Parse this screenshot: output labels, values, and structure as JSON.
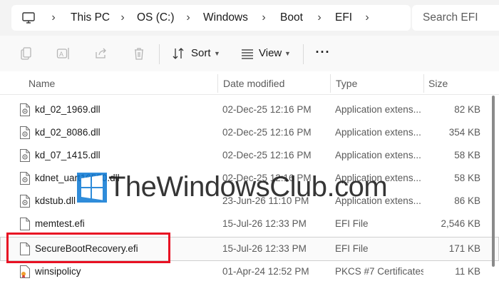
{
  "address": {
    "crumbs": [
      "This PC",
      "OS (C:)",
      "Windows",
      "Boot",
      "EFI"
    ],
    "root_icon": "monitor-icon",
    "separator_icon": "chevron-right-icon"
  },
  "search": {
    "placeholder": "Search EFI"
  },
  "toolbar": {
    "icons": [
      "copy-icon",
      "rename-icon",
      "share-icon",
      "delete-icon"
    ],
    "sort_label": "Sort",
    "view_label": "View",
    "more_label": "···"
  },
  "columns": {
    "name": "Name",
    "date": "Date modified",
    "type": "Type",
    "size": "Size"
  },
  "files": [
    {
      "name": "kd_02_1969.dll",
      "date": "02-Dec-25 12:16 PM",
      "type": "Application extens...",
      "size": "82 KB",
      "icon": "dll-file-icon"
    },
    {
      "name": "kd_02_8086.dll",
      "date": "02-Dec-25 12:16 PM",
      "type": "Application extens...",
      "size": "354 KB",
      "icon": "dll-file-icon"
    },
    {
      "name": "kd_07_1415.dll",
      "date": "02-Dec-25 12:16 PM",
      "type": "Application extens...",
      "size": "58 KB",
      "icon": "dll-file-icon"
    },
    {
      "name": "kdnet_uart16550.dll",
      "date": "02-Dec-25 12:16 PM",
      "type": "Application extens...",
      "size": "58 KB",
      "icon": "dll-file-icon"
    },
    {
      "name": "kdstub.dll",
      "date": "23-Jun-26 11:10 PM",
      "type": "Application extens...",
      "size": "86 KB",
      "icon": "dll-file-icon"
    },
    {
      "name": "memtest.efi",
      "date": "15-Jul-26 12:33 PM",
      "type": "EFI File",
      "size": "2,546 KB",
      "icon": "file-icon"
    },
    {
      "name": "SecureBootRecovery.efi",
      "date": "15-Jul-26 12:33 PM",
      "type": "EFI File",
      "size": "171 KB",
      "icon": "file-icon"
    },
    {
      "name": "winsipolicy",
      "date": "01-Apr-24 12:52 PM",
      "type": "PKCS #7 Certificates",
      "size": "11 KB",
      "icon": "certificate-icon"
    }
  ],
  "watermark": {
    "text": "TheWindowsClub.com"
  },
  "colors": {
    "highlight": "#e81123",
    "windows_blue": "#0a78d4"
  }
}
